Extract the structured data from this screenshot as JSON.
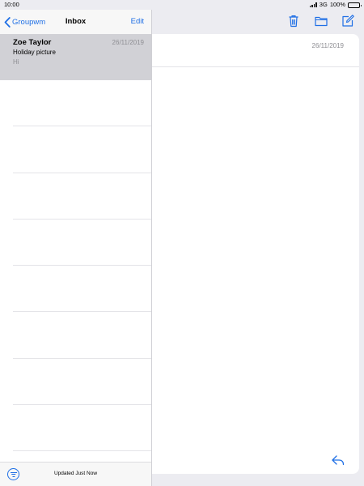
{
  "status_bar": {
    "time": "10:00",
    "network": "3G",
    "battery": "100%",
    "battery_level": 1.0
  },
  "list_panel": {
    "back_label": "Groupwm",
    "title": "Inbox",
    "edit_label": "Edit",
    "messages": [
      {
        "sender": "Zoe Taylor",
        "date": "26/11/2019",
        "subject": "Holiday picture",
        "preview": "Hi",
        "selected": true
      }
    ],
    "footer_status": "Updated Just Now"
  },
  "detail": {
    "date": "26/11/2019",
    "toolbar_icons": [
      "trash-icon",
      "folder-icon",
      "compose-icon"
    ],
    "reply_icon": "reply-icon"
  },
  "colors": {
    "accent": "#1f6fe5",
    "selected_row": "#d1d1d6",
    "background": "#ececf1",
    "secondary_text": "#8e8e93"
  }
}
